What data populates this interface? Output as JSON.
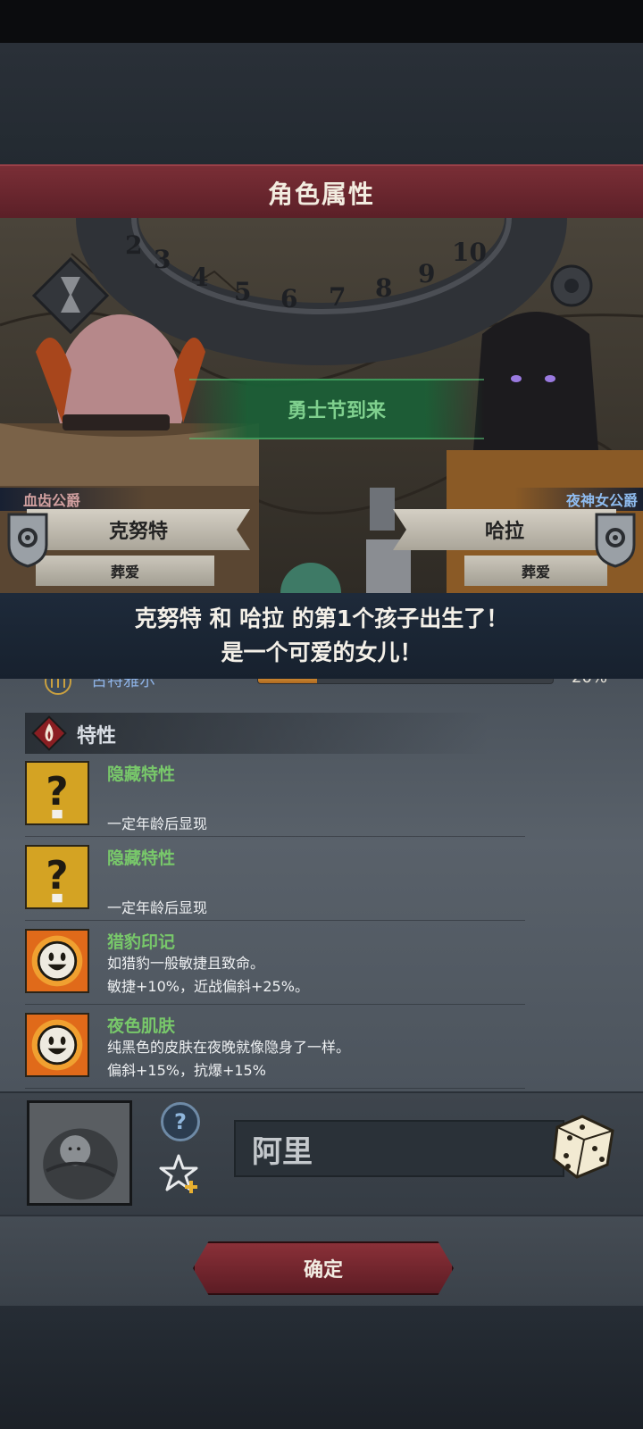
{
  "header": {
    "title": "角色属性"
  },
  "wheel": {
    "numbers": [
      "2",
      "3",
      "4",
      "5",
      "6",
      "7",
      "8",
      "9",
      "10"
    ]
  },
  "event": {
    "banner": "勇士节到来"
  },
  "father": {
    "title": "血齿公爵",
    "name": "克努特",
    "relation": "葬爱"
  },
  "mother": {
    "title": "夜神女公爵",
    "name": "哈拉",
    "relation": "葬爱"
  },
  "announcement": {
    "line1": "克努特 和 哈拉 的第1个孩子出生了！",
    "line2": "是一个可爱的女儿！"
  },
  "relationship": {
    "name": "古特雅尔",
    "percent_label": "20%",
    "progress": 0.2
  },
  "traits_section": {
    "label": "特性"
  },
  "traits": [
    {
      "name": "隐藏特性",
      "desc": "\n一定年龄后显现",
      "icon": "question-mark-icon"
    },
    {
      "name": "隐藏特性",
      "desc": "\n一定年龄后显现",
      "icon": "question-mark-icon"
    },
    {
      "name": "猎豹印记",
      "desc": "如猎豹一般敏捷且致命。\n敏捷+10%，近战偏斜+25%。",
      "icon": "smiley-sun-icon"
    },
    {
      "name": "夜色肌肤",
      "desc": "纯黑色的皮肤在夜晚就像隐身了一样。\n偏斜+15%，抗爆+15%",
      "icon": "smiley-sun-icon"
    }
  ],
  "child": {
    "name_value": "阿里",
    "help_label": "?"
  },
  "actions": {
    "confirm_label": "确定"
  },
  "colors": {
    "accent_red": "#7a2e36",
    "trait_green": "#78c86a",
    "banner_green": "#1a6036"
  }
}
